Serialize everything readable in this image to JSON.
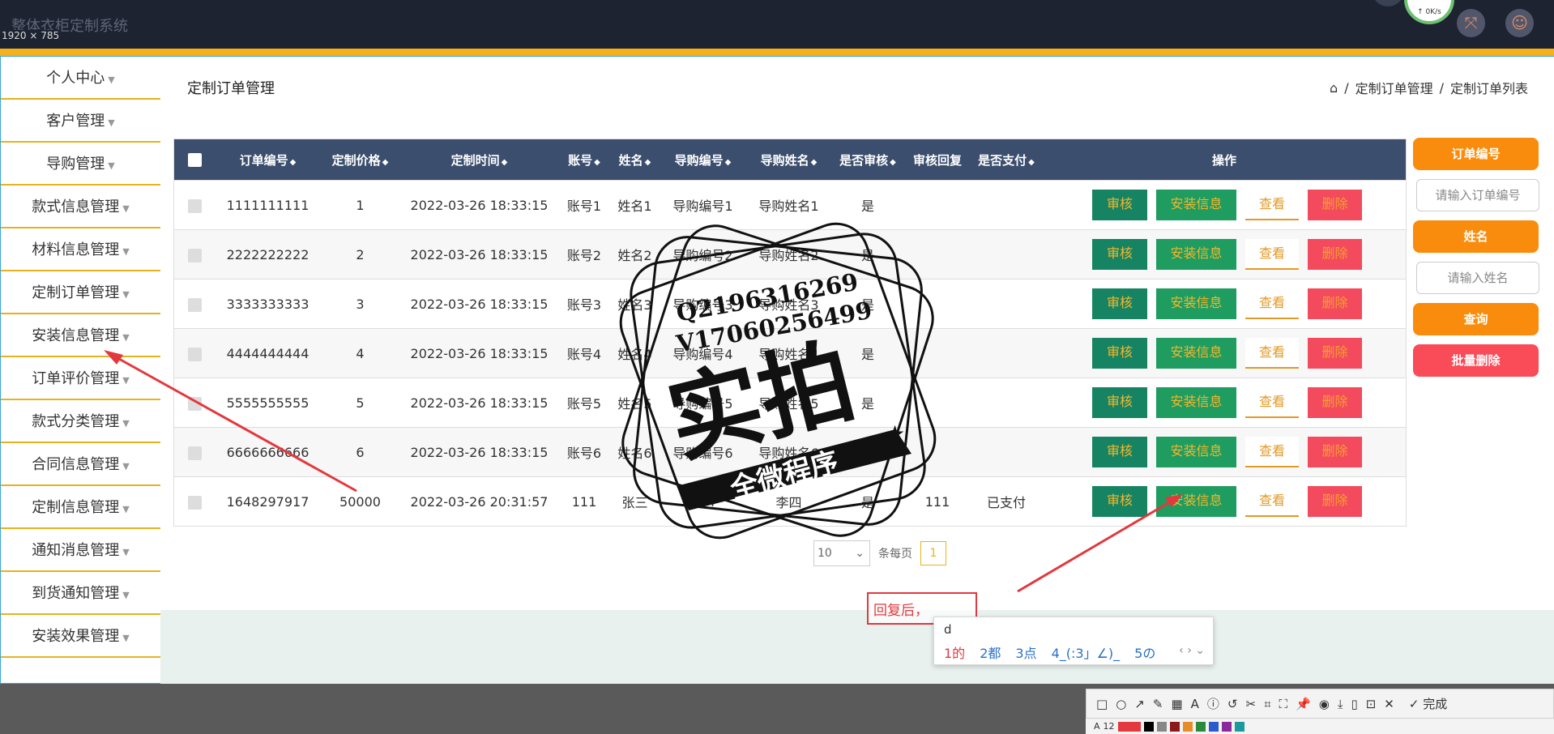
{
  "app": {
    "title": "整体衣柜定制系统",
    "size_label": "1920 × 785",
    "speed": "↑ 0K/s"
  },
  "sidebar": {
    "items": [
      {
        "label": "个人中心"
      },
      {
        "label": "客户管理"
      },
      {
        "label": "导购管理"
      },
      {
        "label": "款式信息管理"
      },
      {
        "label": "材料信息管理"
      },
      {
        "label": "定制订单管理"
      },
      {
        "label": "安装信息管理"
      },
      {
        "label": "订单评价管理"
      },
      {
        "label": "款式分类管理"
      },
      {
        "label": "合同信息管理"
      },
      {
        "label": "定制信息管理"
      },
      {
        "label": "通知消息管理"
      },
      {
        "label": "到货通知管理"
      },
      {
        "label": "安装效果管理"
      }
    ]
  },
  "page": {
    "title": "定制订单管理"
  },
  "breadcrumb": {
    "sep": "/",
    "level1": "定制订单管理",
    "level2": "定制订单列表"
  },
  "table": {
    "headers": [
      "订单编号",
      "定制价格",
      "定制时间",
      "账号",
      "姓名",
      "导购编号",
      "导购姓名",
      "是否审核",
      "审核回复",
      "是否支付",
      "操作"
    ],
    "rows": [
      [
        "1111111111",
        "1",
        "2022-03-26 18:33:15",
        "账号1",
        "姓名1",
        "导购编号1",
        "导购姓名1",
        "是",
        "",
        ""
      ],
      [
        "2222222222",
        "2",
        "2022-03-26 18:33:15",
        "账号2",
        "姓名2",
        "导购编号2",
        "导购姓名2",
        "是",
        "",
        ""
      ],
      [
        "3333333333",
        "3",
        "2022-03-26 18:33:15",
        "账号3",
        "姓名3",
        "导购编号3",
        "导购姓名3",
        "是",
        "",
        ""
      ],
      [
        "4444444444",
        "4",
        "2022-03-26 18:33:15",
        "账号4",
        "姓名4",
        "导购编号4",
        "导购姓名4",
        "是",
        "",
        ""
      ],
      [
        "5555555555",
        "5",
        "2022-03-26 18:33:15",
        "账号5",
        "姓名5",
        "导购编号5",
        "导购姓名5",
        "是",
        "",
        ""
      ],
      [
        "6666666666",
        "6",
        "2022-03-26 18:33:15",
        "账号6",
        "姓名6",
        "导购编号6",
        "导购姓名6",
        "是",
        "",
        ""
      ],
      [
        "1648297917",
        "50000",
        "2022-03-26 20:31:57",
        "111",
        "张三",
        "444",
        "李四",
        "是",
        "111",
        "已支付"
      ]
    ],
    "actions": {
      "audit": "审核",
      "install": "安装信息",
      "view": "查看",
      "delete": "删除"
    }
  },
  "pager": {
    "page_size": "10",
    "per_page_label": "条每页",
    "current_page": "1"
  },
  "search_panel": {
    "order_no_label": "订单编号",
    "order_no_placeholder": "请输入订单编号",
    "name_label": "姓名",
    "name_placeholder": "请输入姓名",
    "query_label": "查询",
    "batch_delete_label": "批量删除"
  },
  "watermark": {
    "line1": "Q2196316269",
    "line2": "V17060256499",
    "big": "实拍",
    "ribbon": "全微程序"
  },
  "annotation": {
    "text": "回复后，"
  },
  "ime": {
    "input": "d",
    "candidates": [
      "1的",
      "2都",
      "3点",
      "4_(:3」∠)_",
      "5の"
    ],
    "nav": "‹ › ⌄"
  },
  "screenshot_toolbar": {
    "done_label": "完成",
    "font_size": "12"
  },
  "colors": {
    "accent": "#f5b01a",
    "header_bg": "#3b4e6e",
    "orange": "#f98c0c",
    "red": "#fa4b58",
    "green": "#168462"
  }
}
